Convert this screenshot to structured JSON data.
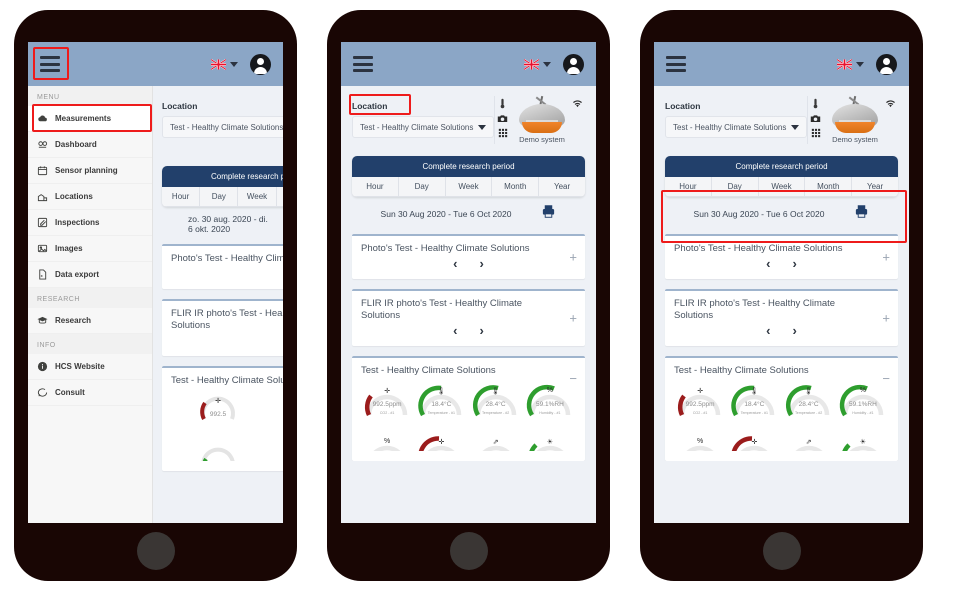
{
  "app": {
    "header": {
      "menu_icon": "hamburger-icon",
      "language_icon": "uk-flag-icon",
      "language_caret": "chevron-down-icon",
      "account_icon": "user-avatar-icon"
    }
  },
  "sidebar": {
    "sections": [
      {
        "label": "MENU",
        "items": [
          {
            "label": "Measurements",
            "icon": "cloud-icon",
            "active": true
          },
          {
            "label": "Dashboard",
            "icon": "dashboard-icon",
            "active": false
          },
          {
            "label": "Sensor planning",
            "icon": "calendar-icon",
            "active": false
          },
          {
            "label": "Locations",
            "icon": "building-icon",
            "active": false
          },
          {
            "label": "Inspections",
            "icon": "edit-icon",
            "active": false
          },
          {
            "label": "Images",
            "icon": "image-icon",
            "active": false
          },
          {
            "label": "Data export",
            "icon": "file-export-icon",
            "active": false
          }
        ]
      },
      {
        "label": "RESEARCH",
        "items": [
          {
            "label": "Research",
            "icon": "graduation-cap-icon",
            "active": false
          }
        ]
      },
      {
        "label": "INFO",
        "items": [
          {
            "label": "HCS Website",
            "icon": "info-icon",
            "active": false
          },
          {
            "label": "Consult",
            "icon": "comment-icon",
            "active": false
          }
        ]
      }
    ]
  },
  "main": {
    "location": {
      "label": "Location",
      "selected": "Test - Healthy Climate Solutions",
      "caret": "chevron-down-icon"
    },
    "device": {
      "name": "Demo system",
      "icons": [
        "thermometer-icon",
        "camera-icon",
        "grid-icon",
        "wifi-icon"
      ]
    },
    "period": {
      "header": "Complete research period",
      "tabs": [
        "Hour",
        "Day",
        "Week",
        "Month",
        "Year"
      ],
      "date_range_en": "Sun 30 Aug 2020 - Tue 6 Oct 2020",
      "date_range_nl": "zo. 30 aug. 2020 - di. 6 okt. 2020",
      "print_icon": "printer-icon"
    },
    "cards": [
      {
        "title": "Photo's Test - Healthy Climate Solutions",
        "toggle": "+",
        "prev": "‹",
        "next": "›"
      },
      {
        "title": "FLIR IR photo's Test - Healthy Climate Solutions",
        "toggle": "+",
        "prev": "‹",
        "next": "›"
      },
      {
        "title": "Test - Healthy Climate Solutions",
        "toggle": "−"
      }
    ],
    "gauges_row1": [
      {
        "icon": "co2-icon",
        "value": "992.5",
        "unit": "ppm",
        "sub": "CO2 - #1",
        "color": "#9b1c1c",
        "pct": 0.82
      },
      {
        "icon": "thermometer-icon",
        "value": "18.4",
        "unit": "°C",
        "sub": "Temperature - #1",
        "color": "#2e9e2e",
        "pct": 0.48
      },
      {
        "icon": "thermometer-icon",
        "value": "28.4",
        "unit": "°C",
        "sub": "Temperature - #2",
        "color": "#2e9e2e",
        "pct": 0.52
      },
      {
        "icon": "humidity-icon",
        "value": "59.1",
        "unit": "%RH",
        "sub": "Humidity - #1",
        "color": "#2e9e2e",
        "pct": 0.55
      }
    ],
    "gauges_row2": [
      {
        "icon": "humidity-icon",
        "color": "#2e9e2e",
        "pct": 0.25
      },
      {
        "icon": "co2-icon",
        "color": "#9b1c1c",
        "pct": 0.8
      },
      {
        "icon": "sound-icon",
        "color": "#cccccc",
        "pct": 0.05
      },
      {
        "icon": "light-icon",
        "color": "#2e9e2e",
        "pct": 0.3
      }
    ]
  },
  "annotations": {
    "phone1": [
      "hamburger-menu-highlight",
      "measurements-menu-item-highlight"
    ],
    "phone2": [
      "location-label-highlight"
    ],
    "phone3": [
      "period-selector-highlight"
    ]
  },
  "colors": {
    "header_bg": "#8ba6c6",
    "content_bg": "#eef1f6",
    "period_header": "#22406b",
    "highlight": "#ee1b1b",
    "gauge_green": "#2e9e2e",
    "gauge_red": "#9b1c1c",
    "phone_frame": "#190604"
  }
}
